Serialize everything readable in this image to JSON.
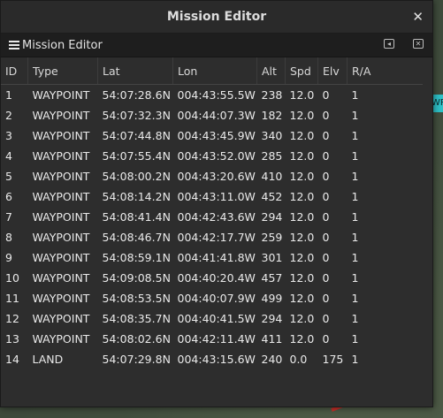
{
  "window": {
    "title": "Mission Editor",
    "close_glyph": "✕"
  },
  "panel": {
    "title": "Mission Editor",
    "undock_glyph": "◂",
    "close_glyph": "✕"
  },
  "map": {
    "chip_text": "WP"
  },
  "table": {
    "headers": [
      "ID",
      "Type",
      "Lat",
      "Lon",
      "Alt",
      "Spd",
      "Elv",
      "R/A"
    ],
    "rows": [
      [
        "1",
        "WAYPOINT",
        "54:07:28.6N",
        "004:43:55.5W",
        "238",
        "12.0",
        "0",
        "1"
      ],
      [
        "2",
        "WAYPOINT",
        "54:07:32.3N",
        "004:44:07.3W",
        "182",
        "12.0",
        "0",
        "1"
      ],
      [
        "3",
        "WAYPOINT",
        "54:07:44.8N",
        "004:43:45.9W",
        "340",
        "12.0",
        "0",
        "1"
      ],
      [
        "4",
        "WAYPOINT",
        "54:07:55.4N",
        "004:43:52.0W",
        "285",
        "12.0",
        "0",
        "1"
      ],
      [
        "5",
        "WAYPOINT",
        "54:08:00.2N",
        "004:43:20.6W",
        "410",
        "12.0",
        "0",
        "1"
      ],
      [
        "6",
        "WAYPOINT",
        "54:08:14.2N",
        "004:43:11.0W",
        "452",
        "12.0",
        "0",
        "1"
      ],
      [
        "7",
        "WAYPOINT",
        "54:08:41.4N",
        "004:42:43.6W",
        "294",
        "12.0",
        "0",
        "1"
      ],
      [
        "8",
        "WAYPOINT",
        "54:08:46.7N",
        "004:42:17.7W",
        "259",
        "12.0",
        "0",
        "1"
      ],
      [
        "9",
        "WAYPOINT",
        "54:08:59.1N",
        "004:41:41.8W",
        "301",
        "12.0",
        "0",
        "1"
      ],
      [
        "10",
        "WAYPOINT",
        "54:09:08.5N",
        "004:40:20.4W",
        "457",
        "12.0",
        "0",
        "1"
      ],
      [
        "11",
        "WAYPOINT",
        "54:08:53.5N",
        "004:40:07.9W",
        "499",
        "12.0",
        "0",
        "1"
      ],
      [
        "12",
        "WAYPOINT",
        "54:08:35.7N",
        "004:40:41.5W",
        "294",
        "12.0",
        "0",
        "1"
      ],
      [
        "13",
        "WAYPOINT",
        "54:08:02.6N",
        "004:42:11.4W",
        "411",
        "12.0",
        "0",
        "1"
      ],
      [
        "14",
        "LAND",
        "54:07:29.8N",
        "004:43:15.6W",
        "240",
        "0.0",
        "175",
        "1"
      ]
    ]
  }
}
